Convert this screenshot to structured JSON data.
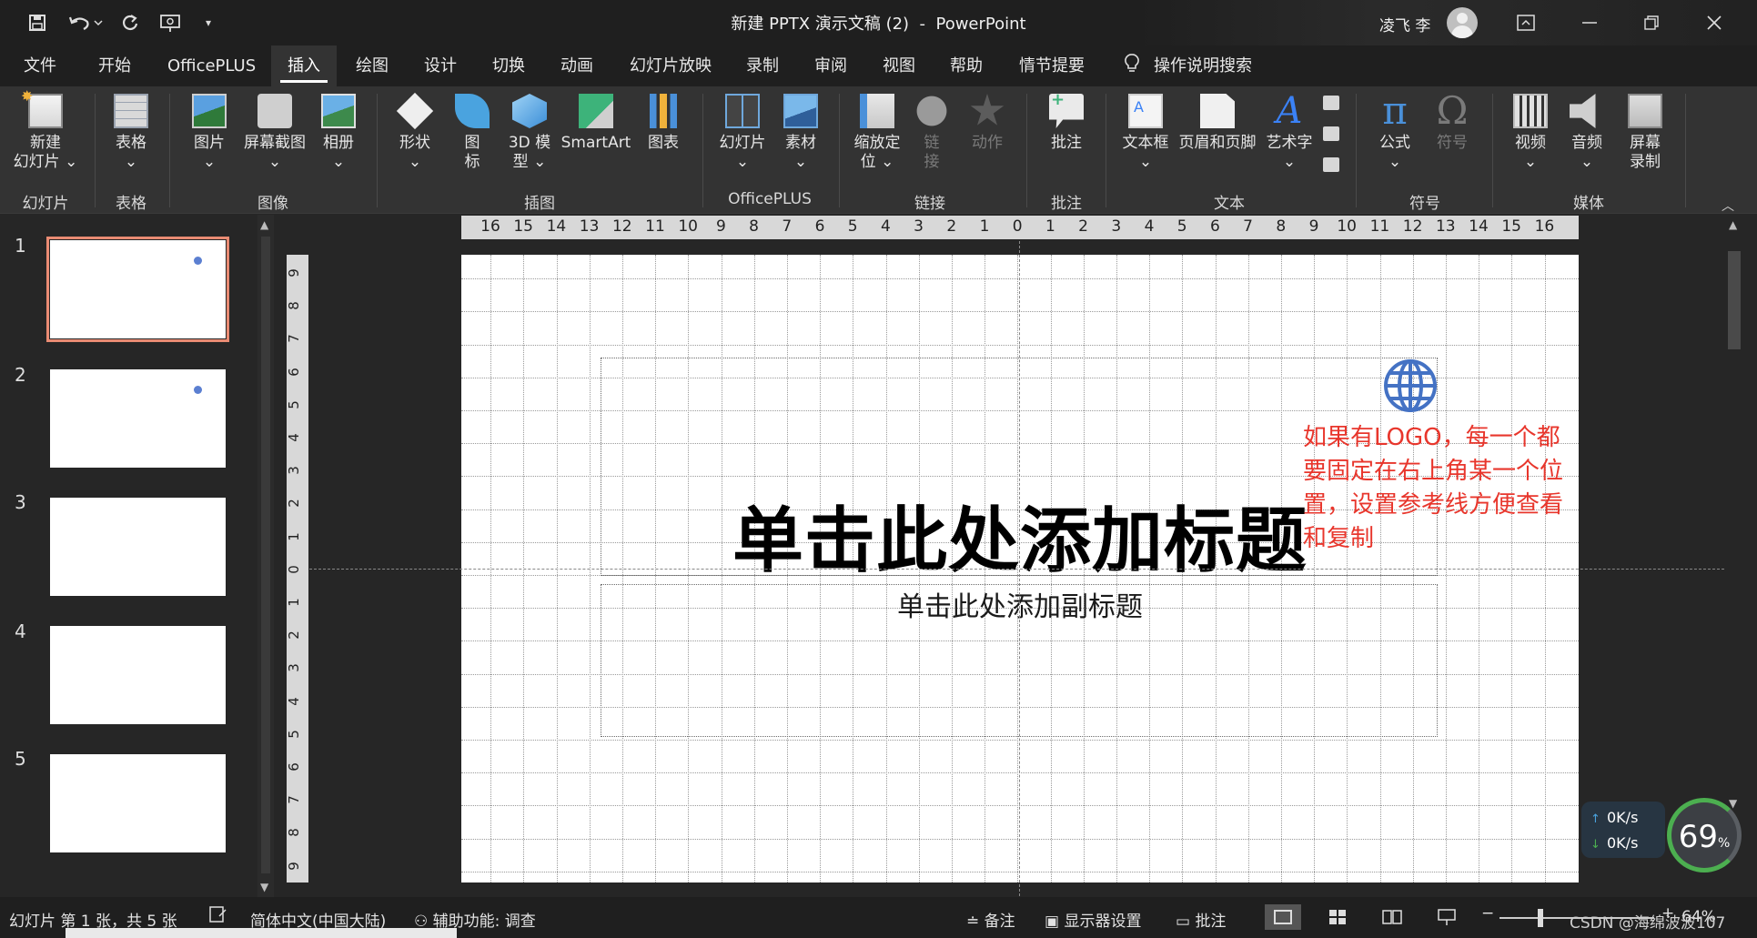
{
  "window": {
    "title_left": "新建 PPTX 演示文稿 (2)",
    "title_sep": "-",
    "title_app": "PowerPoint",
    "user_name": "凌飞 李"
  },
  "quick_access": {
    "save_icon": "save-icon",
    "undo_icon": "undo-icon",
    "redo_icon": "redo-icon",
    "present_icon": "present-from-start-icon",
    "customize_icon": "customize-qat-icon"
  },
  "menu": {
    "tabs": [
      "文件",
      "开始",
      "OfficePLUS",
      "插入",
      "绘图",
      "设计",
      "切换",
      "动画",
      "幻灯片放映",
      "录制",
      "审阅",
      "视图",
      "帮助",
      "情节提要"
    ],
    "active_index": 3,
    "search_label": "操作说明搜索"
  },
  "ribbon": {
    "buttons": {
      "new_slide": "新建\n幻灯片 ⌄",
      "table": "表格\n⌄",
      "picture": "图片\n⌄",
      "screenshot": "屏幕截图\n⌄",
      "album": "相册\n⌄",
      "shapes": "形状\n⌄",
      "icons": "图\n标",
      "model3d": "3D 模\n型 ⌄",
      "smartart": "SmartArt",
      "chart": "图表",
      "slide_lib": "幻灯片\n⌄",
      "material": "素材\n⌄",
      "zoom": "缩放定\n位 ⌄",
      "link": "链\n接",
      "action": "动作",
      "comment": "批注",
      "textbox": "文本框\n⌄",
      "header_footer": "页眉和页脚",
      "wordart": "艺术字\n⌄",
      "equation": "公式\n⌄",
      "symbol": "符号",
      "video": "视频\n⌄",
      "audio": "音频\n⌄",
      "screen_rec": "屏幕\n录制"
    },
    "groups": {
      "slides": "幻灯片",
      "tables": "表格",
      "images": "图像",
      "illustrations": "插图",
      "officeplus": "OfficePLUS",
      "links": "链接",
      "comments": "批注",
      "text": "文本",
      "symbols": "符号",
      "media": "媒体"
    }
  },
  "thumbnails": [
    {
      "num": "1",
      "selected": true,
      "has_logo": true
    },
    {
      "num": "2",
      "selected": false,
      "has_logo": true
    },
    {
      "num": "3",
      "selected": false,
      "has_logo": false
    },
    {
      "num": "4",
      "selected": false,
      "has_logo": false
    },
    {
      "num": "5",
      "selected": false,
      "has_logo": false
    }
  ],
  "rulers": {
    "horizontal": [
      "16",
      "15",
      "14",
      "13",
      "12",
      "11",
      "10",
      "9",
      "8",
      "7",
      "6",
      "5",
      "4",
      "3",
      "2",
      "1",
      "0",
      "1",
      "2",
      "3",
      "4",
      "5",
      "6",
      "7",
      "8",
      "9",
      "10",
      "11",
      "12",
      "13",
      "14",
      "15",
      "16"
    ],
    "vertical": [
      "9",
      "8",
      "7",
      "6",
      "5",
      "4",
      "3",
      "2",
      "1",
      "0",
      "1",
      "2",
      "3",
      "4",
      "5",
      "6",
      "7",
      "8",
      "9"
    ]
  },
  "slide": {
    "title_placeholder": "单击此处添加标题",
    "subtitle_placeholder": "单击此处添加副标题",
    "annotation": "如果有LOGO，每一个都要固定在右上角某一个位置，设置参考线方便查看和复制",
    "logo_icon": "globe-icon",
    "logo_color": "#4472c4",
    "annotation_color": "#e8362c"
  },
  "network": {
    "upload": "0K/s",
    "download": "0K/s",
    "gauge_value": "69",
    "gauge_unit": "%"
  },
  "status": {
    "slide_info": "幻灯片 第 1 张，共 5 张",
    "language": "简体中文(中国大陆)",
    "accessibility": "辅助功能: 调查",
    "notes": "备注",
    "display_settings": "显示器设置",
    "comments": "批注",
    "zoom": "64%"
  },
  "watermark": "CSDN @海绵波波107"
}
